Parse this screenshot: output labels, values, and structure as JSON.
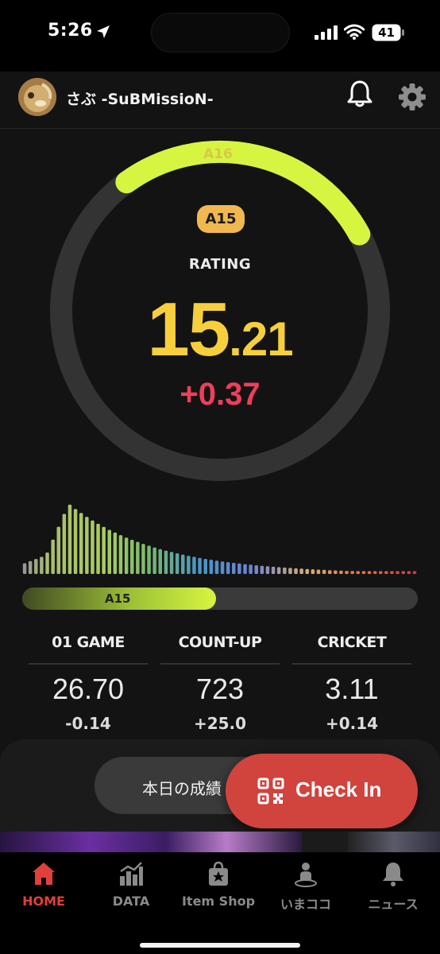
{
  "status_bar": {
    "time": "5:26",
    "battery": "41",
    "icons": [
      "location-arrow-icon",
      "signal-icon",
      "wifi-icon",
      "battery-icon"
    ]
  },
  "header": {
    "username": "さぶ -SuBMissioN-",
    "icons": [
      "avatar",
      "bell-icon",
      "gear-icon"
    ]
  },
  "rating": {
    "next_class": "A16",
    "current_class": "A15",
    "title": "RATING",
    "value_int": "15",
    "value_dec": ".21",
    "delta": "+0.37",
    "ring_progress_fraction": 0.27
  },
  "progress": {
    "label": "A15",
    "fraction": 0.49
  },
  "stats": [
    {
      "name": "01 GAME",
      "value": "26.70",
      "delta": "-0.14"
    },
    {
      "name": "COUNT-UP",
      "value": "723",
      "delta": "+25.0"
    },
    {
      "name": "CRICKET",
      "value": "3.11",
      "delta": "+0.14"
    }
  ],
  "actions": {
    "today_results": "本日の成績",
    "check_in": "Check In"
  },
  "tabs": [
    {
      "label": "HOME",
      "icon": "home-icon",
      "active": true
    },
    {
      "label": "DATA",
      "icon": "chart-icon",
      "active": false
    },
    {
      "label": "Item Shop",
      "icon": "shop-bag-icon",
      "active": false
    },
    {
      "label": "いまココ",
      "icon": "person-pin-icon",
      "active": false
    },
    {
      "label": "ニュース",
      "icon": "bell-icon",
      "active": false
    }
  ],
  "colors": {
    "accent_lime": "#d6f541",
    "rating_yellow": "#f7cf3c",
    "delta_red": "#ef3e5c",
    "checkin_red": "#d1433d",
    "badge_orange": "#f0b84f"
  }
}
